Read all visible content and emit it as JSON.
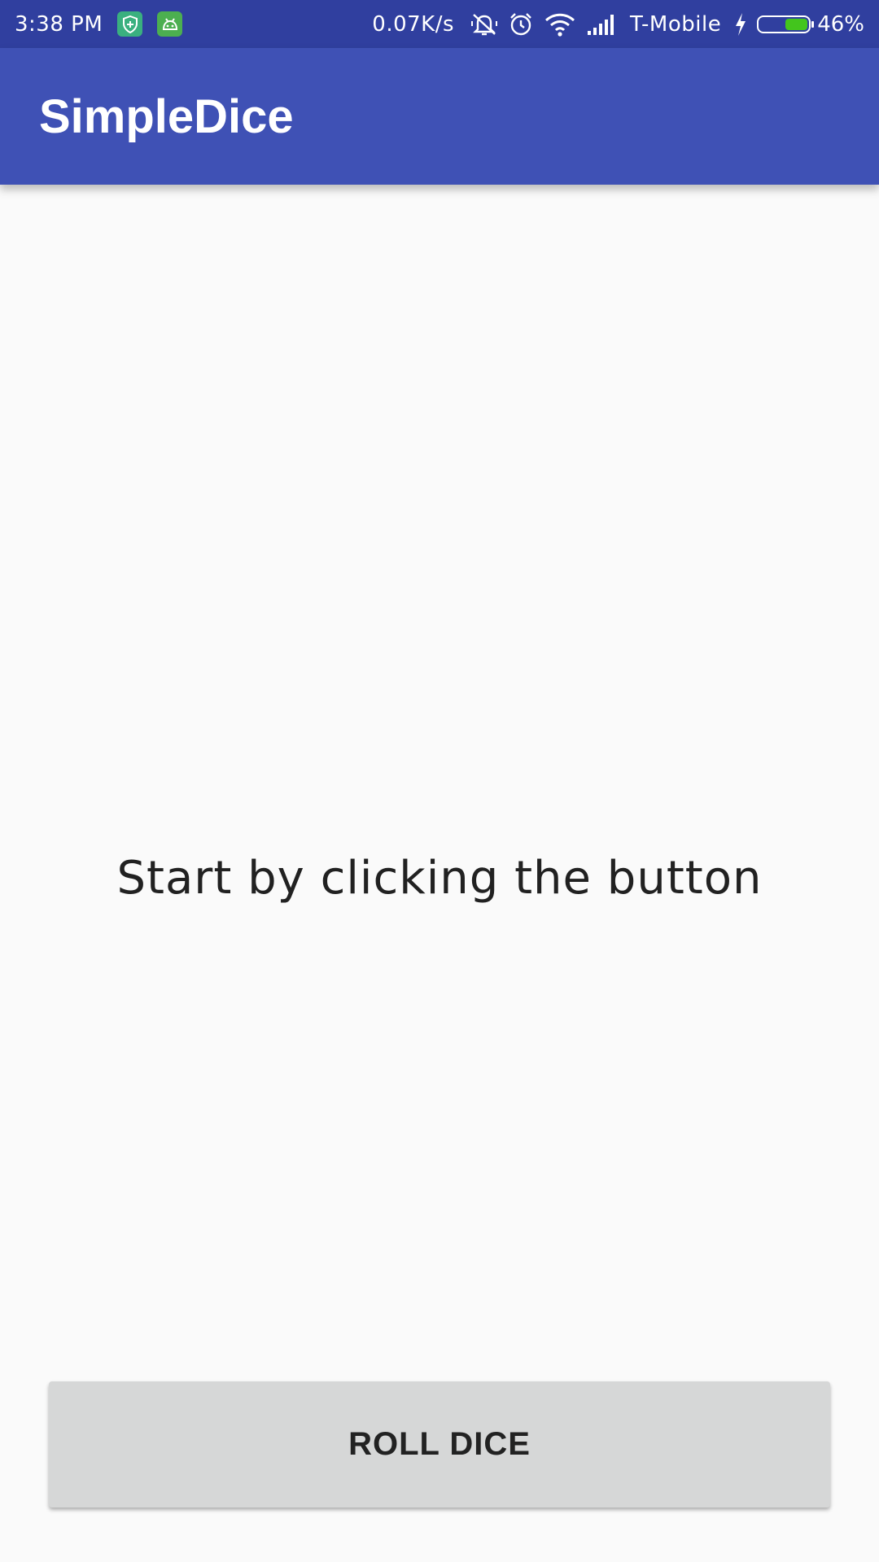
{
  "status_bar": {
    "time": "3:38 PM",
    "network_speed": "0.07K/s",
    "carrier": "T-Mobile",
    "battery_percent": "46%",
    "battery_level": 0.46,
    "icons": [
      "shield-notification-icon",
      "android-notification-icon",
      "silent-bell-icon",
      "alarm-clock-icon",
      "wifi-icon",
      "signal-bars-icon",
      "charging-bolt-icon",
      "battery-icon"
    ],
    "colors": {
      "background": "#303f9f",
      "battery_fill": "#43c51d",
      "notif_teal": "#3ab07f",
      "notif_green": "#4caf50"
    }
  },
  "app_bar": {
    "title": "SimpleDice",
    "color": "#3f51b5"
  },
  "main": {
    "prompt": "Start by clicking the button"
  },
  "actions": {
    "roll_label": "ROLL DICE",
    "button_color": "#d6d7d7"
  }
}
